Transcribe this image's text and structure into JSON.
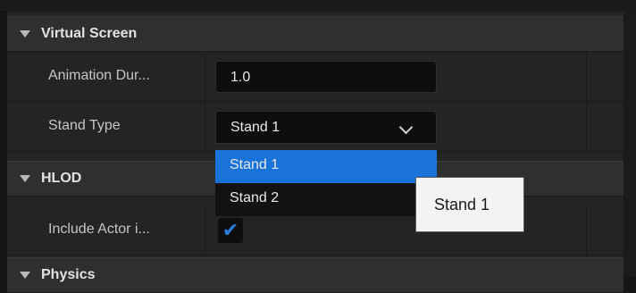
{
  "sections": {
    "virtual_screen": {
      "title": "Virtual Screen"
    },
    "hlod": {
      "title": "HLOD"
    },
    "physics": {
      "title": "Physics"
    }
  },
  "rows": {
    "animation_duration": {
      "label": "Animation Dur...",
      "value": "1.0"
    },
    "stand_type": {
      "label": "Stand Type",
      "value": "Stand 1",
      "options": [
        "Stand 1",
        "Stand 2"
      ],
      "selected_index": 0
    },
    "include_actor": {
      "label": "Include Actor i...",
      "checked": true
    }
  },
  "tooltip": {
    "text": "Stand 1"
  },
  "colors": {
    "accent": "#1a73d9",
    "checkmark": "#2a7fdd"
  }
}
